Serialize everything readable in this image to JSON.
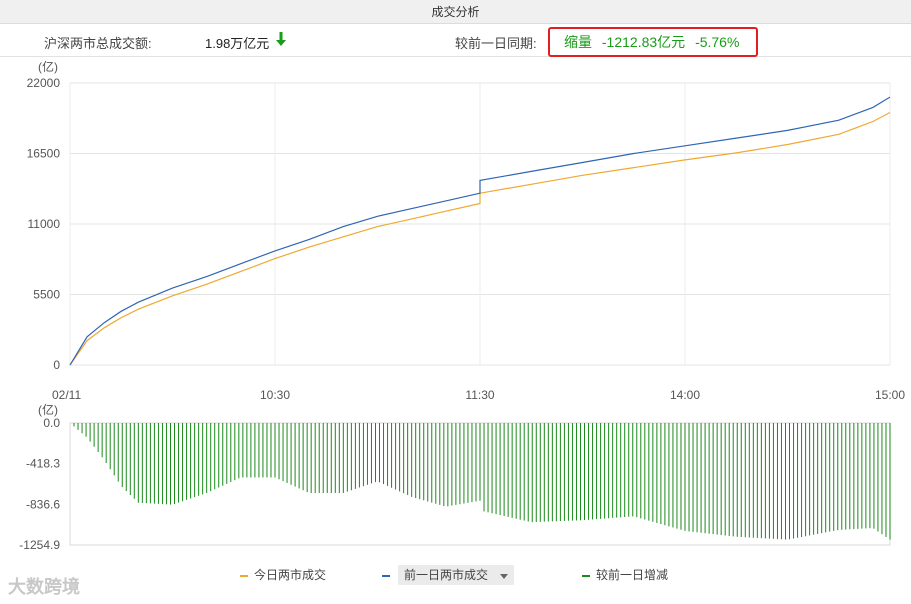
{
  "window": {
    "title": "成交分析"
  },
  "summary": {
    "total_label": "沪深两市总成交额:",
    "total_value": "1.98万亿元",
    "total_trend": "down",
    "compare_label": "较前一日同期:",
    "change_word": "缩量",
    "change_amount": "-1212.83亿元",
    "change_pct": "-5.76%"
  },
  "colors": {
    "today": "#f0a830",
    "previous": "#2f66b3",
    "diff": "#1a8a1a",
    "highlight_border": "#e02020"
  },
  "legend": {
    "today": "今日两市成交",
    "previous": "前一日两市成交",
    "diff": "较前一日增减"
  },
  "watermark": "大数跨境",
  "chart_data": [
    {
      "type": "line",
      "ylabel": "(亿)",
      "ylim": [
        0,
        22000
      ],
      "yticks": [
        "22000",
        "16500",
        "11000",
        "5500",
        "0"
      ],
      "xticks": [
        "02/11",
        "10:30",
        "11:30",
        "14:00",
        "15:00"
      ],
      "x": [
        "09:30",
        "09:35",
        "09:40",
        "09:45",
        "09:50",
        "10:00",
        "10:10",
        "10:20",
        "10:30",
        "10:40",
        "10:50",
        "11:00",
        "11:10",
        "11:20",
        "11:30",
        "13:00",
        "13:15",
        "13:30",
        "13:45",
        "14:00",
        "14:15",
        "14:30",
        "14:45",
        "14:55",
        "15:00"
      ],
      "series": [
        {
          "name": "今日两市成交",
          "values": [
            0,
            1900,
            2900,
            3700,
            4350,
            5400,
            6300,
            7300,
            8300,
            9200,
            10000,
            10800,
            11400,
            12000,
            12600,
            13400,
            14100,
            14800,
            15400,
            16000,
            16550,
            17200,
            18000,
            19000,
            19700
          ]
        },
        {
          "name": "前一日两市成交",
          "values": [
            0,
            2200,
            3300,
            4200,
            4900,
            6000,
            6900,
            7900,
            8900,
            9800,
            10800,
            11600,
            12200,
            12800,
            13400,
            14400,
            15100,
            15800,
            16500,
            17100,
            17700,
            18300,
            19100,
            20100,
            20900
          ]
        }
      ]
    },
    {
      "type": "bar",
      "title": "较前一日增减",
      "ylabel": "(亿)",
      "ylim": [
        -1254.9,
        0
      ],
      "yticks": [
        "0.0",
        "-418.3",
        "-836.6",
        "-1254.9"
      ],
      "x": [
        "09:30",
        "09:35",
        "09:40",
        "09:45",
        "09:50",
        "10:00",
        "10:10",
        "10:20",
        "10:30",
        "10:40",
        "10:50",
        "11:00",
        "11:10",
        "11:20",
        "11:30",
        "13:00",
        "13:15",
        "13:30",
        "13:45",
        "14:00",
        "14:15",
        "14:30",
        "14:45",
        "14:55",
        "15:00"
      ],
      "values": [
        0,
        -150,
        -380,
        -650,
        -820,
        -840,
        -720,
        -560,
        -560,
        -720,
        -720,
        -600,
        -760,
        -860,
        -800,
        -900,
        -1020,
        -1000,
        -960,
        -1110,
        -1170,
        -1200,
        -1100,
        -1080,
        -1200
      ]
    }
  ]
}
